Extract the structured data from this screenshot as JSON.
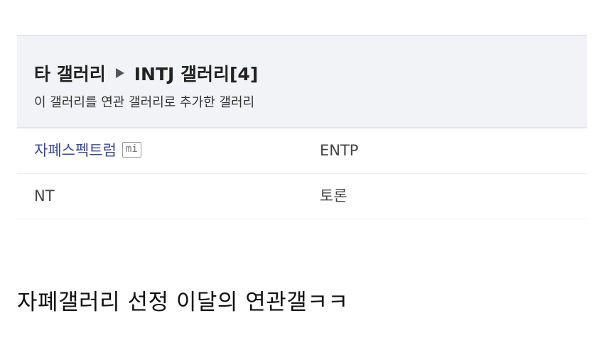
{
  "panel": {
    "breadcrumb_parent": "타 갤러리",
    "breadcrumb_current": "INTJ 갤러리[4]",
    "subtitle": "이 갤러리를 연관 갤러리로 추가한 갤러리"
  },
  "related_galleries": [
    {
      "name": "자폐스펙트럼",
      "badge": "mi",
      "right": "ENTP"
    },
    {
      "name": "NT",
      "right": "토론"
    }
  ],
  "caption": "자폐갤러리 선정 이달의 연관갤ㅋㅋ",
  "colors": {
    "panel_bg": "#f1f3f7",
    "link": "#3b4a8f",
    "text": "#222222"
  },
  "icons": {
    "breadcrumb_separator": "triangle-right-icon"
  }
}
